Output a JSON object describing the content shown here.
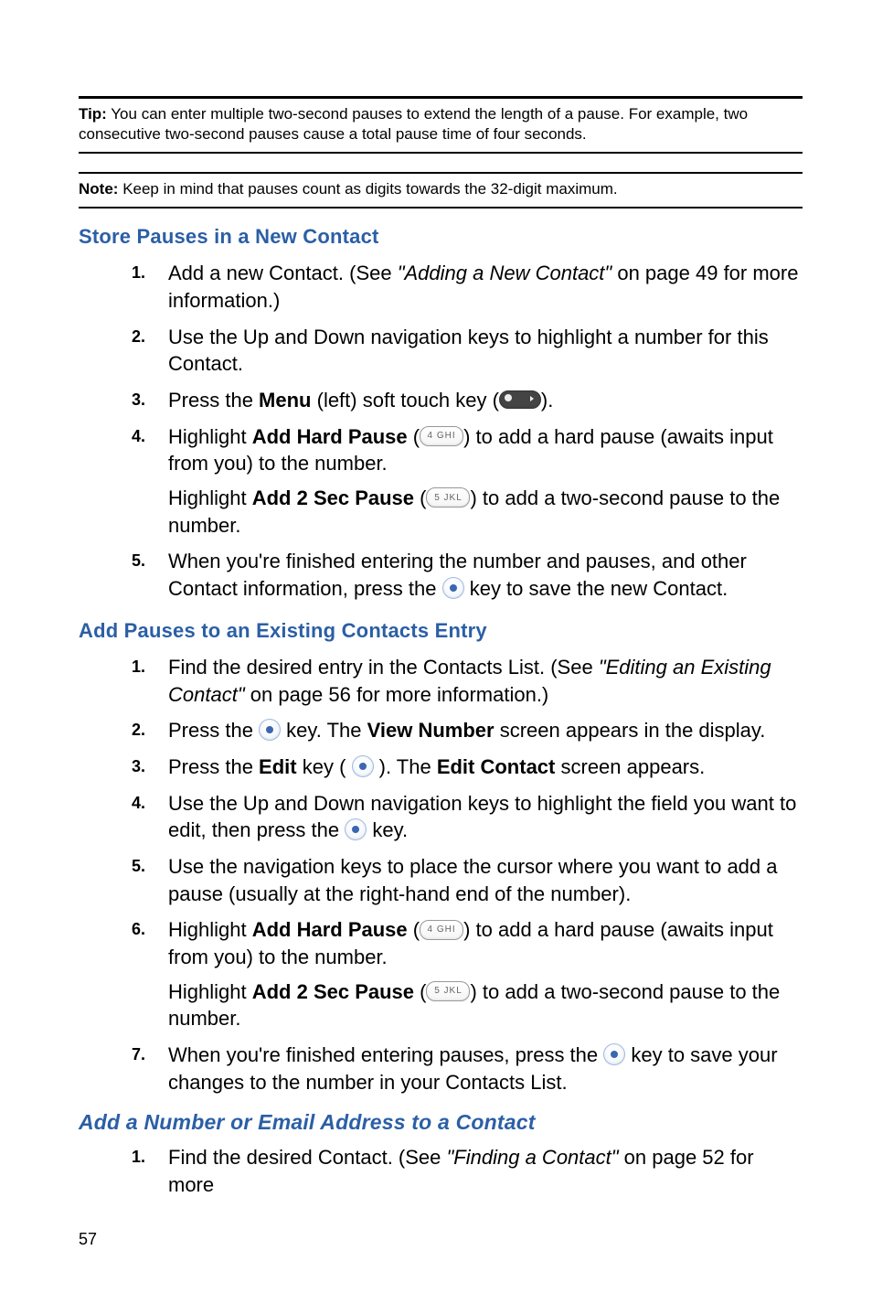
{
  "tip": {
    "label": "Tip:",
    "text": "You can enter multiple two-second pauses to extend the length of a pause. For example, two consecutive two-second pauses cause a total pause time of four seconds."
  },
  "note": {
    "label": "Note:",
    "text": "Keep in mind that pauses count as digits towards the 32-digit maximum."
  },
  "sec1": {
    "title": "Store Pauses in a New Contact",
    "s1": {
      "n": "1.",
      "a": "Add a new Contact. (See ",
      "ref": "\"Adding a New Contact\"",
      "b": " on page 49 for more information.)"
    },
    "s2": {
      "n": "2.",
      "t": "Use the Up and Down navigation keys to highlight a number for this Contact."
    },
    "s3": {
      "n": "3.",
      "a": "Press the ",
      "menu": "Menu",
      "b": " (left) soft touch key (",
      "c": ")."
    },
    "s4": {
      "n": "4.",
      "a": "Highlight ",
      "hp": "Add Hard Pause",
      "b": " (",
      "k4": "4 GHI",
      "c": ") to add a hard pause (awaits input from you) to the number.",
      "d": "Highlight ",
      "sp": "Add 2 Sec Pause",
      "e": " (",
      "k5": "5 JKL",
      "f": ") to add a two-second pause to the number."
    },
    "s5": {
      "n": "5.",
      "a": "When you're finished entering the number and pauses, and other Contact information, press the ",
      "b": " key to save the new Contact."
    }
  },
  "sec2": {
    "title": "Add Pauses to an Existing Contacts Entry",
    "s1": {
      "n": "1.",
      "a": "Find the desired entry in the Contacts List. (See ",
      "ref": "\"Editing an Existing Contact\"",
      "b": " on page 56 for more information.)"
    },
    "s2": {
      "n": "2.",
      "a": "Press the ",
      "b": " key. The ",
      "vn": "View Number",
      "c": " screen appears in the display."
    },
    "s3": {
      "n": "3.",
      "a": "Press the ",
      "edit": "Edit",
      "b": " key ( ",
      "c": " ). The ",
      "ec": "Edit Contact",
      "d": " screen appears."
    },
    "s4": {
      "n": "4.",
      "a": "Use the Up and Down navigation keys to highlight the field you want to edit, then press the ",
      "b": " key."
    },
    "s5": {
      "n": "5.",
      "t": "Use the navigation keys to place the cursor where you want to add a pause (usually at the right-hand end of the number)."
    },
    "s6": {
      "n": "6.",
      "a": "Highlight ",
      "hp": "Add Hard Pause",
      "b": " (",
      "k4": "4 GHI",
      "c": ") to add a hard pause (awaits input from you) to the number.",
      "d": "Highlight ",
      "sp": "Add 2 Sec Pause",
      "e": " (",
      "k5": "5 JKL",
      "f": ") to add a two-second pause to the number."
    },
    "s7": {
      "n": "7.",
      "a": "When you're finished entering pauses, press the ",
      "b": " key to save your changes to the number in your Contacts List."
    }
  },
  "sec3": {
    "title": "Add a Number or Email Address to a Contact",
    "s1": {
      "n": "1.",
      "a": "Find the desired Contact. (See ",
      "ref": "\"Finding a Contact\"",
      "b": " on page 52 for more"
    }
  },
  "page_number": "57"
}
